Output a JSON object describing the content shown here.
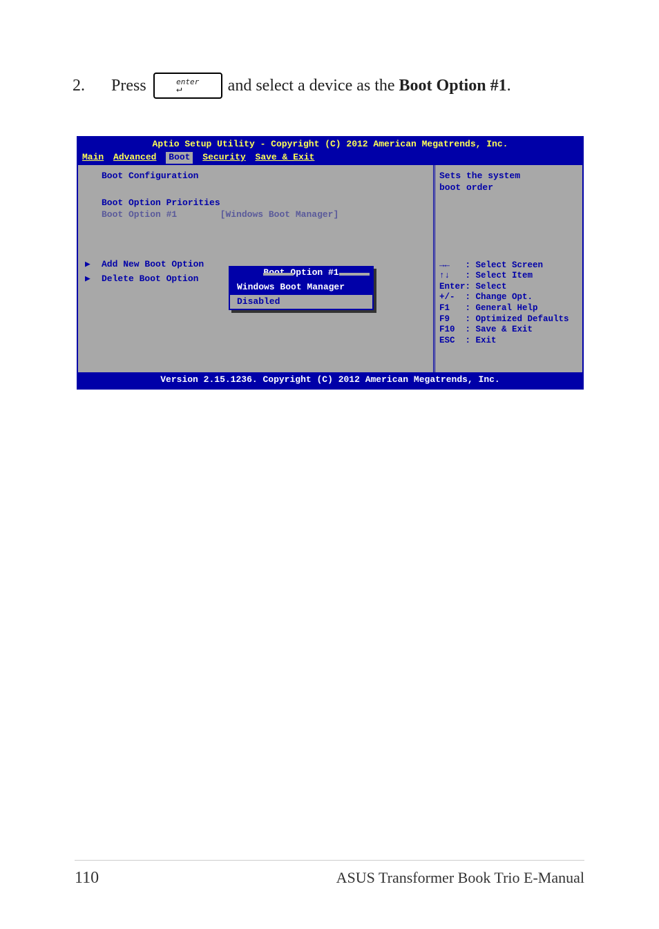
{
  "instruction": {
    "step": "2.",
    "press": "Press",
    "key_label": "enter",
    "after_pre": " and select a device as the ",
    "bold_part": "Boot Option #1",
    "after_post": "."
  },
  "bios": {
    "title": "Aptio Setup Utility - Copyright (C) 2012 American Megatrends, Inc.",
    "tabs": [
      "Main",
      "Advanced",
      "Boot",
      "Security",
      "Save & Exit"
    ],
    "active_tab_index": 2,
    "boot_configuration": "Boot Configuration",
    "boot_priorities": "Boot Option Priorities",
    "boot_option_label": "Boot Option #1",
    "boot_option_value": "[Windows Boot Manager]",
    "menu_items": [
      "Add New Boot Option",
      "Delete Boot Option"
    ],
    "popup": {
      "title": "Boot Option #1",
      "items": [
        "Windows Boot Manager",
        "Disabled"
      ],
      "selected_index": 0
    },
    "side_desc_l1": "Sets the system",
    "side_desc_l2": "boot order",
    "side_keys": [
      {
        "k": "→←  ",
        "d": ": Select Screen"
      },
      {
        "k": "↑↓  ",
        "d": ": Select Item"
      },
      {
        "k": "Enter",
        "d": ": Select"
      },
      {
        "k": "+/- ",
        "d": ": Change Opt."
      },
      {
        "k": "F1  ",
        "d": ": General Help"
      },
      {
        "k": "F9  ",
        "d": ": Optimized Defaults"
      },
      {
        "k": "F10 ",
        "d": ": Save & Exit"
      },
      {
        "k": "ESC ",
        "d": ": Exit"
      }
    ],
    "footer": "Version 2.15.1236. Copyright (C) 2012 American Megatrends, Inc."
  },
  "page": {
    "number": "110",
    "title": "ASUS Transformer Book Trio E-Manual"
  }
}
